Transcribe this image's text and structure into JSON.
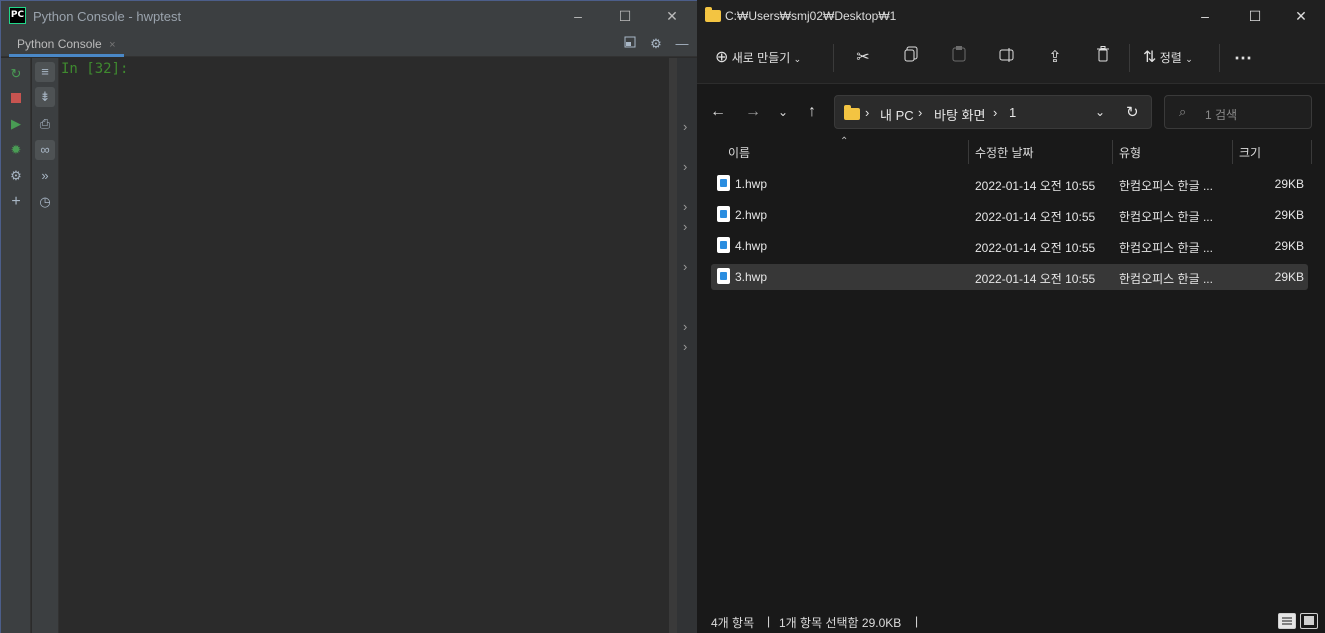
{
  "pycharm": {
    "logo": "PC",
    "title": "Python Console - hwptest",
    "tab_label": "Python Console",
    "tab_close": "×",
    "prompt": "In [32]:",
    "colors": {
      "accent": "#4a88c7",
      "prompt": "#3f8a2f",
      "run_green": "#499c54",
      "stop_red": "#c75450"
    },
    "window_buttons": [
      "–",
      "☐",
      "✕"
    ]
  },
  "explorer": {
    "title": "C:₩Users₩smj02₩Desktop₩1",
    "window_buttons": [
      "–",
      "☐",
      "✕"
    ],
    "toolbar": {
      "new_label": "새로 만들기",
      "sort_label": "정렬",
      "more": "⋯"
    },
    "breadcrumb": [
      "내 PC",
      "바탕 화면",
      "1"
    ],
    "search_placeholder": "1 검색",
    "columns": {
      "name": "이름",
      "date": "수정한 날짜",
      "type": "유형",
      "size": "크기"
    },
    "files": [
      {
        "name": "1.hwp",
        "date": "2022-01-14 오전 10:55",
        "type": "한컴오피스 한글 ...",
        "size": "29KB",
        "selected": false
      },
      {
        "name": "2.hwp",
        "date": "2022-01-14 오전 10:55",
        "type": "한컴오피스 한글 ...",
        "size": "29KB",
        "selected": false
      },
      {
        "name": "4.hwp",
        "date": "2022-01-14 오전 10:55",
        "type": "한컴오피스 한글 ...",
        "size": "29KB",
        "selected": false
      },
      {
        "name": "3.hwp",
        "date": "2022-01-14 오전 10:55",
        "type": "한컴오피스 한글 ...",
        "size": "29KB",
        "selected": true
      }
    ],
    "status": {
      "count": "4개 항목",
      "sep": "|",
      "selection": "1개 항목 선택함 29.0KB"
    },
    "colors": {
      "folder": "#f3c442",
      "selected_row": "#373737"
    }
  }
}
